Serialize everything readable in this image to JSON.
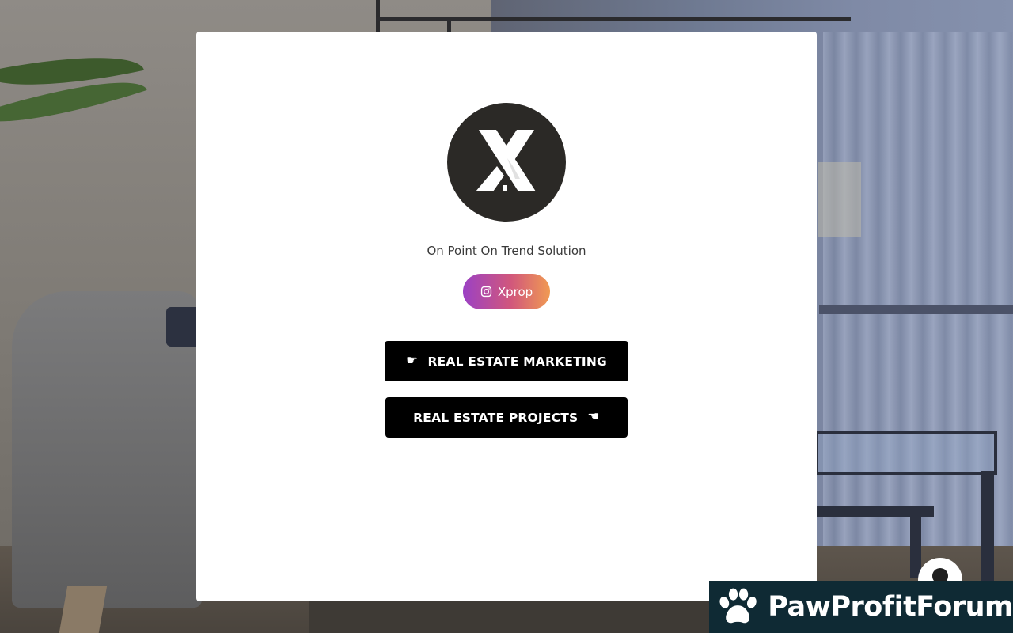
{
  "profile": {
    "logo_letter": "X",
    "tagline": "On Point On Trend Solution"
  },
  "social": {
    "platform_icon": "instagram-icon",
    "label": "Xprop",
    "gradient": [
      "#9b41c4",
      "#d1577c",
      "#f09a52"
    ]
  },
  "links": [
    {
      "label": "REAL ESTATE MARKETING",
      "icon": "hand-pointing-right-icon",
      "icon_position": "left"
    },
    {
      "label": "REAL ESTATE PROJECTS",
      "icon": "hand-pointing-left-icon",
      "icon_position": "right"
    }
  ],
  "floating_button": {
    "icon": "user-icon"
  },
  "watermark": {
    "text": "PawProfitForum",
    "icon": "paw-icon",
    "background": "#0f2a34"
  },
  "colors": {
    "card_background": "#ffffff",
    "button_background": "#000000",
    "button_text": "#ffffff",
    "avatar_background": "#2b2926"
  }
}
